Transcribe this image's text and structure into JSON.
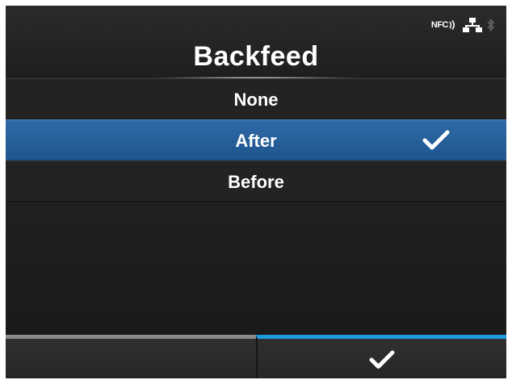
{
  "header": {
    "title": "Backfeed",
    "status_icons": {
      "nfc_label": "NFC",
      "icons": [
        "nfc-icon",
        "network-icon",
        "bluetooth-icon"
      ]
    }
  },
  "options": [
    {
      "label": "None",
      "selected": false
    },
    {
      "label": "After",
      "selected": true
    },
    {
      "label": "Before",
      "selected": false
    }
  ],
  "selected_check_icon": "checkmark-icon",
  "softkeys": {
    "left": {
      "icon": "",
      "accent": "#8a8a8a"
    },
    "right": {
      "icon": "checkmark-icon",
      "accent": "#1e9ae0"
    }
  },
  "colors": {
    "background": "#1f1f1f",
    "selected_row": "#2a64a0",
    "text": "#ffffff"
  }
}
